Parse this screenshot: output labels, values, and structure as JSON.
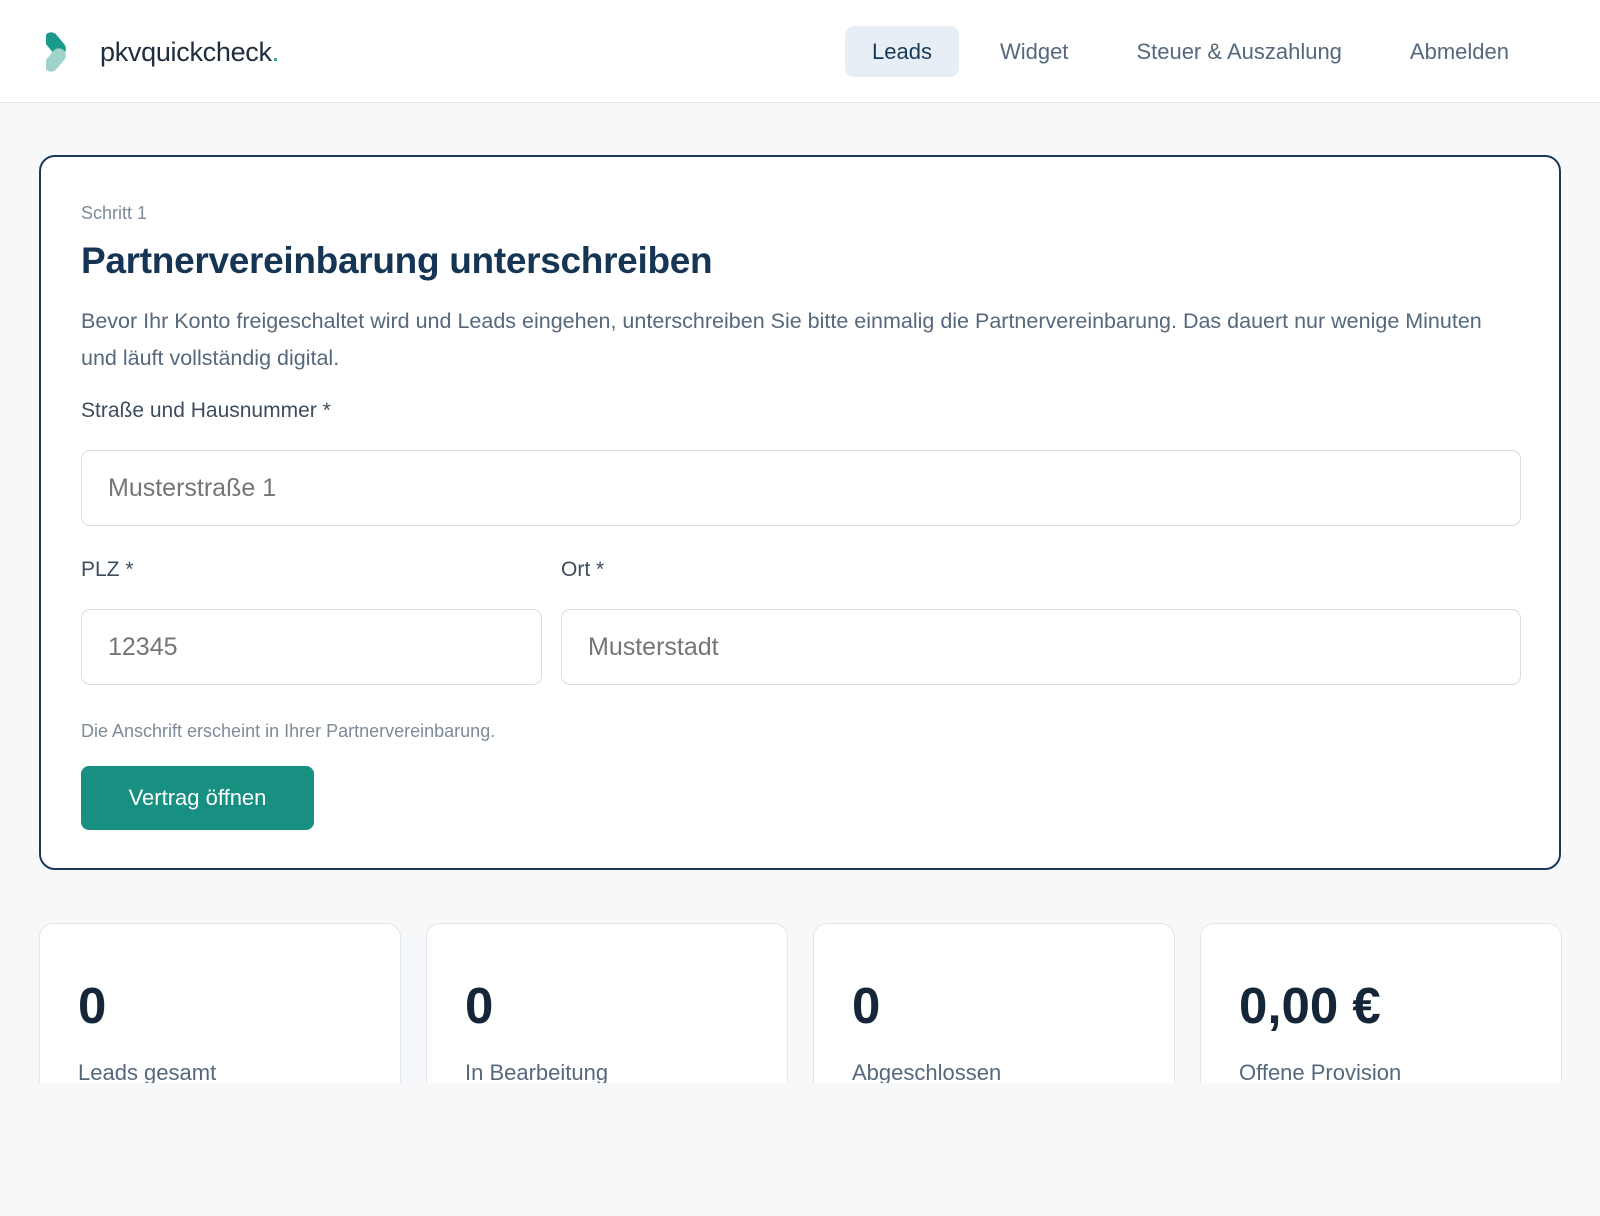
{
  "header": {
    "logo_text": "pkvquickcheck",
    "logo_dot": ".",
    "nav": [
      {
        "label": "Leads",
        "active": true
      },
      {
        "label": "Widget",
        "active": false
      },
      {
        "label": "Steuer & Auszahlung",
        "active": false
      },
      {
        "label": "Abmelden",
        "active": false
      }
    ]
  },
  "onboarding": {
    "step": "Schritt 1",
    "title": "Partnervereinbarung unterschreiben",
    "description": "Bevor Ihr Konto freigeschaltet wird und Leads eingehen, unterschreiben Sie bitte einmalig die Partnervereinbarung. Das dauert nur wenige Minuten und läuft vollständig digital.",
    "street": {
      "label": "Straße und Hausnummer *",
      "value": "",
      "placeholder": "Musterstraße 1"
    },
    "zip": {
      "label": "PLZ *",
      "value": "",
      "placeholder": "12345"
    },
    "city": {
      "label": "Ort *",
      "value": "",
      "placeholder": "Musterstadt"
    },
    "hint": "Die Anschrift erscheint in Ihrer Partnervereinbarung.",
    "button_label": "Vertrag öffnen"
  },
  "stats": [
    {
      "value": "0",
      "label": "Leads gesamt"
    },
    {
      "value": "0",
      "label": "In Bearbeitung"
    },
    {
      "value": "0",
      "label": "Abgeschlossen"
    },
    {
      "value": "0,00 €",
      "label": "Offene Provision"
    }
  ],
  "colors": {
    "accent": "#178f81",
    "primary_text": "#163555",
    "nav_active_bg": "#e8eef5",
    "card_border": "#1b3a5a",
    "page_bg": "#f7f8fa"
  }
}
